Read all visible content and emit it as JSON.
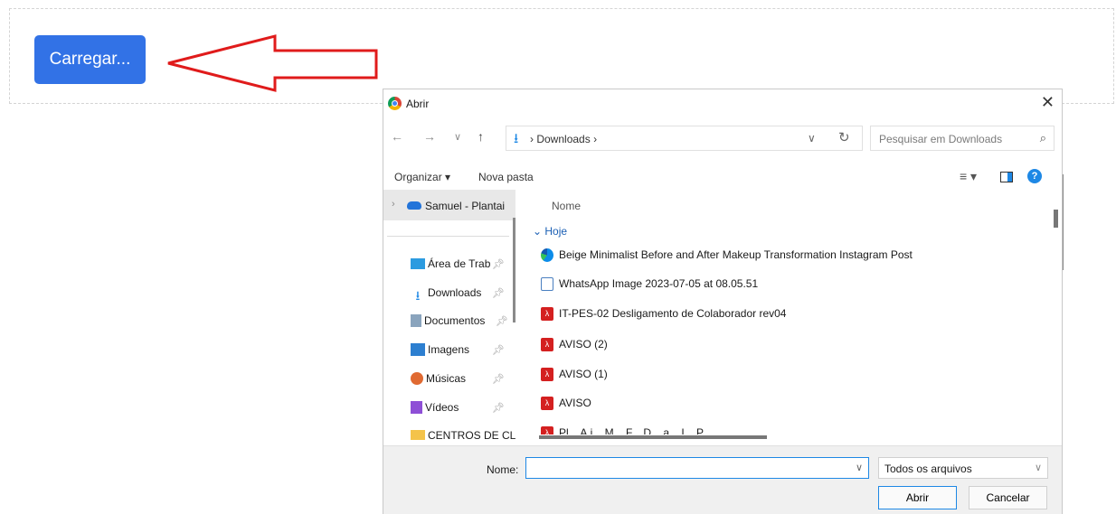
{
  "upload": {
    "button_label": "Carregar..."
  },
  "dialog": {
    "title": "Abrir",
    "close": "✕",
    "nav": {
      "back": "←",
      "forward": "→",
      "recent": "∨",
      "up": "↑"
    },
    "address": {
      "path": "Downloads",
      "separator": "›",
      "dropdown": "∨",
      "refresh": "↻"
    },
    "search": {
      "placeholder": "Pesquisar em Downloads",
      "icon": "⌕"
    },
    "toolbar": {
      "organize": "Organizar ▾",
      "new_folder": "Nova pasta",
      "view_icon": "≡ ▾",
      "help": "?"
    },
    "sidebar": {
      "group": {
        "label": "Samuel - Plantai",
        "chevron": "›"
      },
      "items": [
        {
          "label": "Área de Trab",
          "icon": "desktop",
          "pinned": true
        },
        {
          "label": "Downloads",
          "icon": "download",
          "pinned": true
        },
        {
          "label": "Documentos",
          "icon": "document",
          "pinned": true
        },
        {
          "label": "Imagens",
          "icon": "image",
          "pinned": true
        },
        {
          "label": "Músicas",
          "icon": "music",
          "pinned": true
        },
        {
          "label": "Vídeos",
          "icon": "video",
          "pinned": true
        },
        {
          "label": "CENTROS DE CL",
          "icon": "folder",
          "pinned": false
        }
      ]
    },
    "files": {
      "column_name": "Nome",
      "group_label": "Hoje",
      "items": [
        {
          "name": "Beige Minimalist Before and After Makeup Transformation Instagram Post",
          "type": "edge"
        },
        {
          "name": "WhatsApp Image 2023-07-05 at 08.05.51",
          "type": "image"
        },
        {
          "name": "IT-PES-02 Desligamento de Colaborador rev04",
          "type": "pdf"
        },
        {
          "name": "AVISO (2)",
          "type": "pdf"
        },
        {
          "name": "AVISO (1)",
          "type": "pdf"
        },
        {
          "name": "AVISO",
          "type": "pdf"
        },
        {
          "name": "Pl... A.i... M... F... D... a... I... P...",
          "type": "pdf"
        }
      ]
    },
    "footer": {
      "name_label": "Nome:",
      "name_value": "",
      "file_type": "Todos os arquivos",
      "open_button": "Abrir",
      "cancel_button": "Cancelar"
    }
  }
}
